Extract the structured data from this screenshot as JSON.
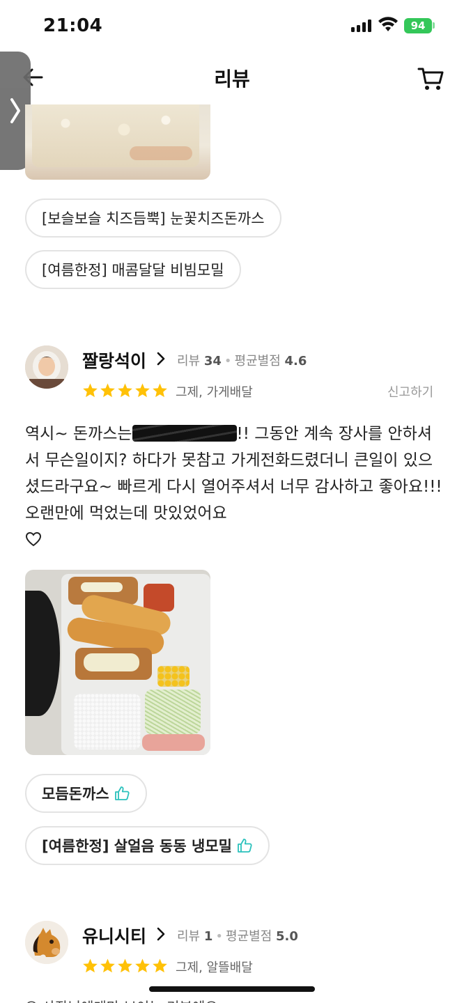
{
  "status_bar": {
    "time": "21:04",
    "battery": "94"
  },
  "nav": {
    "title": "리뷰",
    "back_icon": "back-arrow-icon",
    "cart_icon": "cart-icon"
  },
  "side_handle": {
    "icon": "chevron-right-icon"
  },
  "review1": {
    "menu_tags": [
      "[보슬보슬 치즈듬뿍] 눈꽃치즈돈까스",
      "[여름한정] 매콤달달 비빔모밀"
    ]
  },
  "review2": {
    "reviewer": "짤랑석이",
    "review_count_label": "리뷰",
    "review_count": "34",
    "avg_rating_label": "평균별점",
    "avg_rating": "4.6",
    "stars": 5,
    "order_info": "그제, 가게배달",
    "report_label": "신고하기",
    "text_before": "역시~ 돈까스는",
    "text_after": "!! 그동안 계속 장사를 안하셔서 무슨일이지? 하다가 못참고 가게전화드렸더니 큰일이 있으셨드라구요~ 빠르게 다시 열어주셔서 너무 감사하고 좋아요!!! 오랜만에 먹었는데 맛있었어요",
    "menu_tags": [
      "모듬돈까스",
      "[여름한정] 살얼음 동동 냉모밀"
    ]
  },
  "review3": {
    "reviewer": "유니시티",
    "review_count_label": "리뷰",
    "review_count": "1",
    "avg_rating_label": "평균별점",
    "avg_rating": "5.0",
    "stars": 5,
    "order_info": "그제, 알뜰배달",
    "partial_text": "오 사장님에게만 보이는 리뷰에요"
  },
  "colors": {
    "star": "#ffc107",
    "like": "#2ac1bc",
    "battery": "#34c759"
  }
}
